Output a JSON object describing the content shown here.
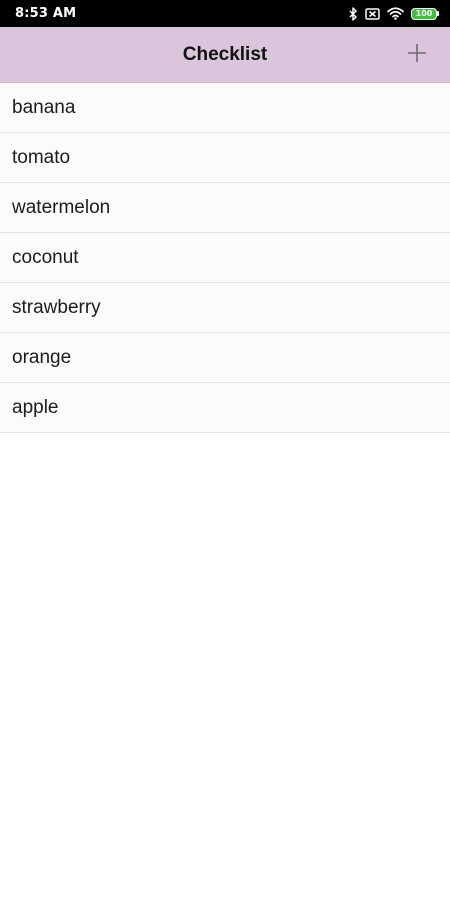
{
  "status_bar": {
    "time": "8:53 AM",
    "battery_level": "100",
    "icons": [
      "bluetooth-icon",
      "sim-icon",
      "wifi-icon",
      "battery-icon"
    ]
  },
  "app_bar": {
    "title": "Checklist",
    "add_icon": "plus-icon",
    "background_color": "#dbc5dc"
  },
  "checklist": {
    "items": [
      {
        "label": "banana"
      },
      {
        "label": "tomato"
      },
      {
        "label": "watermelon"
      },
      {
        "label": "coconut"
      },
      {
        "label": "strawberry"
      },
      {
        "label": "orange"
      },
      {
        "label": "apple"
      }
    ]
  }
}
